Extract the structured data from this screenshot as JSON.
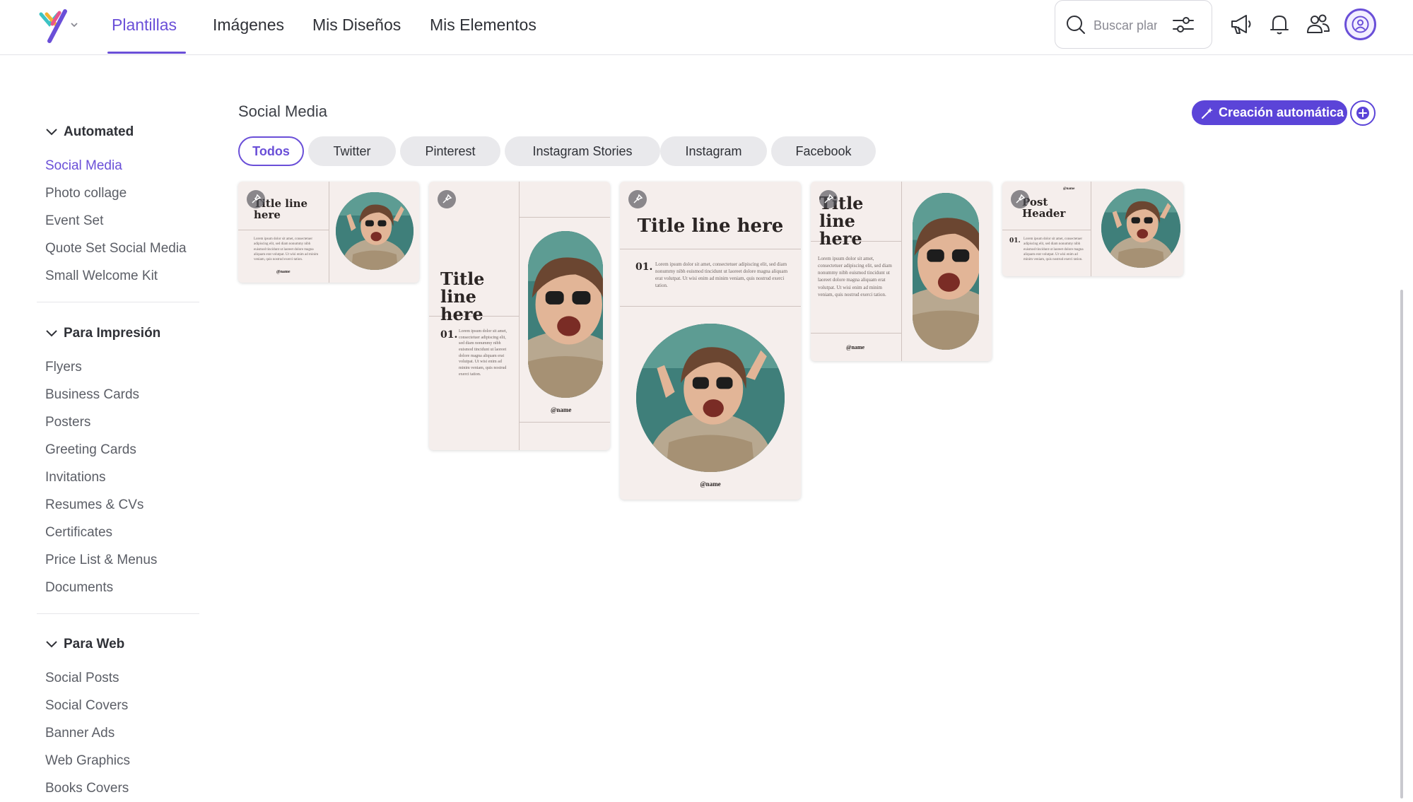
{
  "header": {
    "nav": [
      "Plantillas",
      "Imágenes",
      "Mis Diseños",
      "Mis Elementos"
    ],
    "search_placeholder": "Buscar plantillas"
  },
  "sidebar": {
    "sections": [
      {
        "title": "Automated",
        "items": [
          "Social Media",
          "Photo collage",
          "Event Set",
          "Quote Set Social Media",
          "Small Welcome Kit"
        ]
      },
      {
        "title": "Para Impresión",
        "items": [
          "Flyers",
          "Business Cards",
          "Posters",
          "Greeting Cards",
          "Invitations",
          "Resumes & CVs",
          "Certificates",
          "Price List & Menus",
          "Documents"
        ]
      },
      {
        "title": "Para Web",
        "items": [
          "Social Posts",
          "Social Covers",
          "Banner Ads",
          "Web Graphics",
          "Books Covers"
        ]
      }
    ],
    "active_item": "Social Media"
  },
  "main": {
    "title": "Social Media",
    "auto_button": "Creación automática",
    "chips": [
      "Todos",
      "Twitter",
      "Pinterest",
      "Instagram Stories",
      "Instagram",
      "Facebook"
    ],
    "active_chip": "Todos",
    "templates": [
      {
        "title": "Title line here",
        "handle": "@name"
      },
      {
        "title": "Title line here",
        "number": "01.",
        "handle": "@name"
      },
      {
        "title": "Title line here",
        "number": "01.",
        "handle": "@name"
      },
      {
        "title": "Title line here",
        "handle": "@name"
      },
      {
        "title": "Post Header",
        "number": "01.",
        "handle": "@name"
      }
    ],
    "lorem": "Lorem ipsum dolor sit amet, consectetuer adipiscing elit, sed diam nonummy nibh euismod tincidunt ut laoreet dolore magna aliquam erat volutpat. Ut wisi enim ad minim veniam, quis nostrud exerci tation."
  },
  "colors": {
    "accent": "#6a4fd8",
    "button": "#5b44d8",
    "card_bg": "#f5eeec"
  }
}
